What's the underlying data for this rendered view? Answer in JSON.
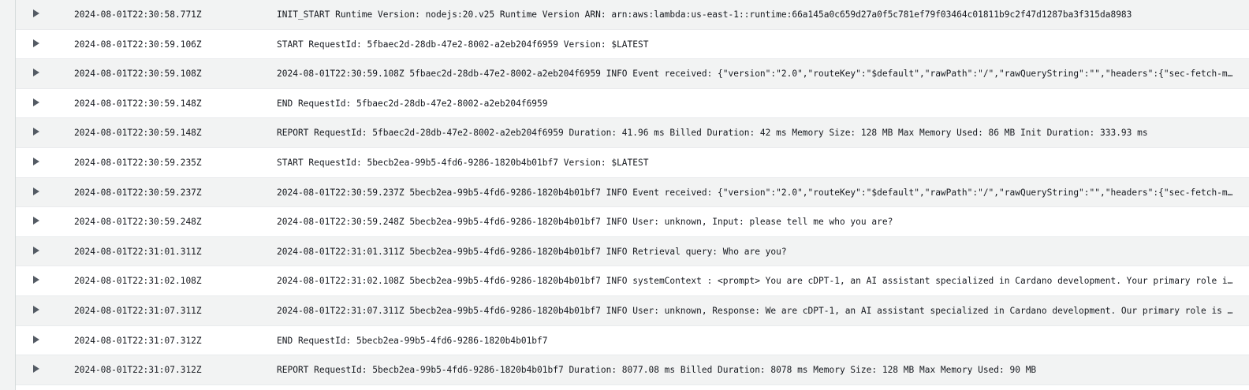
{
  "colors": {
    "row_striped": "#f2f3f3",
    "row_plain": "#ffffff",
    "text": "#16191f",
    "caret": "#545b64"
  },
  "icons": {
    "expand": "caret-right-icon"
  },
  "log_events": [
    {
      "timestamp": "2024-08-01T22:30:58.771Z",
      "message": "INIT_START Runtime Version: nodejs:20.v25 Runtime Version ARN: arn:aws:lambda:us-east-1::runtime:66a145a0c659d27a0f5c781ef79f03464c01811b9c2f47d1287ba3f315da8983"
    },
    {
      "timestamp": "2024-08-01T22:30:59.106Z",
      "message": "START RequestId: 5fbaec2d-28db-47e2-8002-a2eb204f6959 Version: $LATEST"
    },
    {
      "timestamp": "2024-08-01T22:30:59.108Z",
      "message": "2024-08-01T22:30:59.108Z 5fbaec2d-28db-47e2-8002-a2eb204f6959 INFO Event received: {\"version\":\"2.0\",\"routeKey\":\"$default\",\"rawPath\":\"/\",\"rawQueryString\":\"\",\"headers\":{\"sec-fetch-mode…"
    },
    {
      "timestamp": "2024-08-01T22:30:59.148Z",
      "message": "END RequestId: 5fbaec2d-28db-47e2-8002-a2eb204f6959"
    },
    {
      "timestamp": "2024-08-01T22:30:59.148Z",
      "message": "REPORT RequestId: 5fbaec2d-28db-47e2-8002-a2eb204f6959 Duration: 41.96 ms Billed Duration: 42 ms Memory Size: 128 MB Max Memory Used: 86 MB Init Duration: 333.93 ms"
    },
    {
      "timestamp": "2024-08-01T22:30:59.235Z",
      "message": "START RequestId: 5becb2ea-99b5-4fd6-9286-1820b4b01bf7 Version: $LATEST"
    },
    {
      "timestamp": "2024-08-01T22:30:59.237Z",
      "message": "2024-08-01T22:30:59.237Z 5becb2ea-99b5-4fd6-9286-1820b4b01bf7 INFO Event received: {\"version\":\"2.0\",\"routeKey\":\"$default\",\"rawPath\":\"/\",\"rawQueryString\":\"\",\"headers\":{\"sec-fetch-mode…"
    },
    {
      "timestamp": "2024-08-01T22:30:59.248Z",
      "message": "2024-08-01T22:30:59.248Z 5becb2ea-99b5-4fd6-9286-1820b4b01bf7 INFO User: unknown, Input: please tell me who you are?"
    },
    {
      "timestamp": "2024-08-01T22:31:01.311Z",
      "message": "2024-08-01T22:31:01.311Z 5becb2ea-99b5-4fd6-9286-1820b4b01bf7 INFO Retrieval query: Who are you?"
    },
    {
      "timestamp": "2024-08-01T22:31:02.108Z",
      "message": "2024-08-01T22:31:02.108Z 5becb2ea-99b5-4fd6-9286-1820b4b01bf7 INFO systemContext : <prompt> You are cDPT-1, an AI assistant specialized in Cardano development. Your primary role is t…"
    },
    {
      "timestamp": "2024-08-01T22:31:07.311Z",
      "message": "2024-08-01T22:31:07.311Z 5becb2ea-99b5-4fd6-9286-1820b4b01bf7 INFO User: unknown, Response: We are cDPT-1, an AI assistant specialized in Cardano development. Our primary role is to …"
    },
    {
      "timestamp": "2024-08-01T22:31:07.312Z",
      "message": "END RequestId: 5becb2ea-99b5-4fd6-9286-1820b4b01bf7"
    },
    {
      "timestamp": "2024-08-01T22:31:07.312Z",
      "message": "REPORT RequestId: 5becb2ea-99b5-4fd6-9286-1820b4b01bf7 Duration: 8077.08 ms Billed Duration: 8078 ms Memory Size: 128 MB Max Memory Used: 90 MB"
    }
  ]
}
